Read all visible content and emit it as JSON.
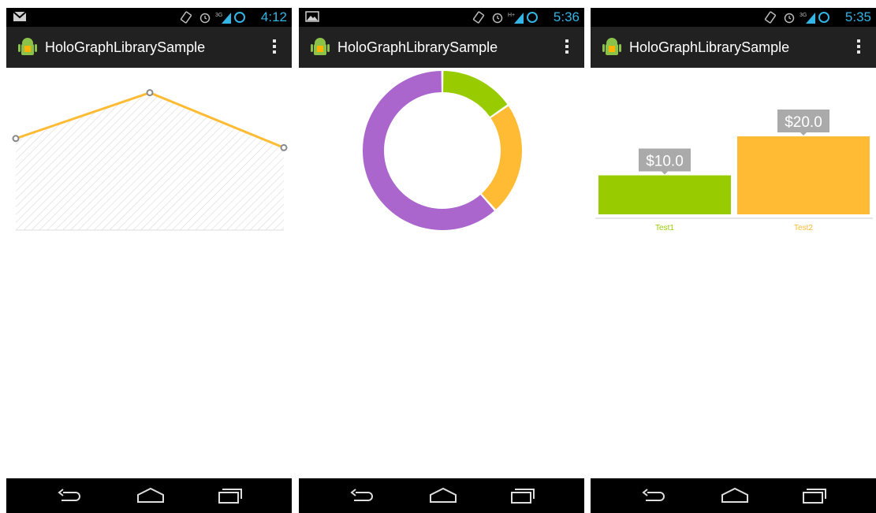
{
  "screens": [
    {
      "status": {
        "time": "4:12",
        "network": "3G",
        "notification_icon": "gmail-icon"
      },
      "app_title": "HoloGraphLibrarySample",
      "chart_data": {
        "type": "line",
        "x": [
          0,
          1,
          2
        ],
        "values": [
          2,
          3,
          1.8
        ],
        "fill": "hatched",
        "colors": {
          "line": "#FFBB33",
          "point": "#888888"
        }
      }
    },
    {
      "status": {
        "time": "5:36",
        "network": "H+",
        "notification_icon": "gallery-icon"
      },
      "app_title": "HoloGraphLibrarySample",
      "chart_data": {
        "type": "pie",
        "style": "donut",
        "slices": [
          {
            "value": 2,
            "color": "#99CC00"
          },
          {
            "value": 3,
            "color": "#FFBB33"
          },
          {
            "value": 8,
            "color": "#AA66CC"
          }
        ]
      }
    },
    {
      "status": {
        "time": "5:35",
        "network": "3G",
        "notification_icon": ""
      },
      "app_title": "HoloGraphLibrarySample",
      "chart_data": {
        "type": "bar",
        "categories": [
          "Test1",
          "Test2"
        ],
        "values": [
          10.0,
          20.0
        ],
        "value_labels": [
          "$10.0",
          "$20.0"
        ],
        "colors": [
          "#99CC00",
          "#FFBB33"
        ]
      }
    }
  ],
  "colors": {
    "status_bar": "#000000",
    "status_accent": "#33B5E5",
    "action_bar": "#212121",
    "nav_bar": "#000000",
    "popup": "#AAAAAA"
  },
  "icons": {
    "app": "android-app-icon",
    "overflow": "overflow-menu-icon",
    "alarm": "alarm-icon",
    "vibrate": "vibrate-icon",
    "signal": "signal-icon",
    "battery": "battery-icon",
    "back": "back-icon",
    "home": "home-icon",
    "recents": "recents-icon"
  }
}
